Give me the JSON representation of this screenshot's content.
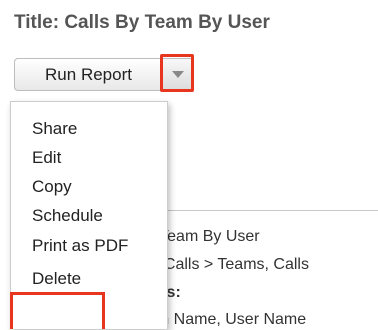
{
  "report": {
    "title": "Title: Calls By Team By User"
  },
  "toolbar": {
    "run_report_label": "Run Report"
  },
  "menu": {
    "items": [
      "Share",
      "Edit",
      "Copy",
      "Schedule",
      "Print as PDF",
      "Delete"
    ]
  },
  "details": {
    "line1": "y Team By User",
    "line2": "s, Calls > Teams, Calls",
    "line3": "nns:",
    "line4": "am Name, User Name"
  },
  "highlight_color": "#e8351e"
}
